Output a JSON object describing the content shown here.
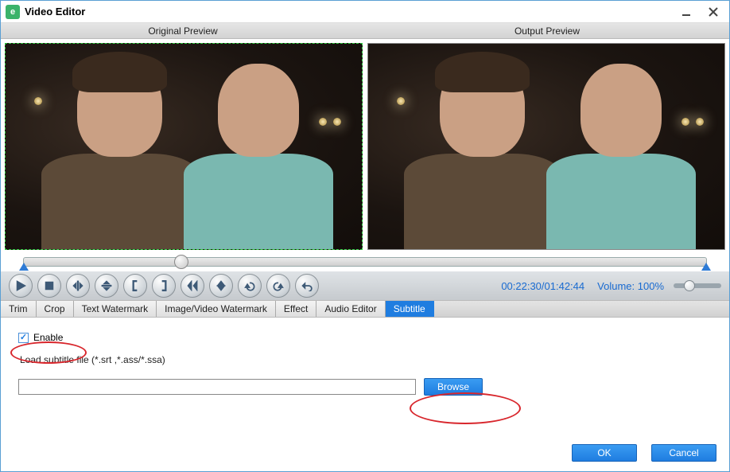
{
  "window": {
    "title": "Video Editor"
  },
  "titlebar_icons": {
    "minimize": "minimize",
    "close": "close"
  },
  "preview_headers": {
    "original": "Original Preview",
    "output": "Output Preview"
  },
  "controls": {
    "play": "play",
    "stop": "stop",
    "flip_h": "flip-horizontal",
    "flip_v": "flip-vertical",
    "bracket_in": "set-in",
    "bracket_out": "set-out",
    "goto_in": "goto-in",
    "cut": "cut",
    "rotate_ccw": "rotate-ccw",
    "rotate_cw": "rotate-cw",
    "undo": "undo"
  },
  "status": {
    "timecode": "00:22:30/01:42:44",
    "volume_label": "Volume:",
    "volume_value": "100%"
  },
  "tabs": {
    "trim": "Trim",
    "crop": "Crop",
    "text_watermark": "Text Watermark",
    "image_watermark": "Image/Video Watermark",
    "effect": "Effect",
    "audio_editor": "Audio Editor",
    "subtitle": "Subtitle",
    "active": "subtitle"
  },
  "subtitle_tab": {
    "enable_label": "Enable",
    "enable_checked": true,
    "load_label": "Load subtitle file (*.srt ,*.ass/*.ssa)",
    "file_value": "",
    "browse_label": "Browse"
  },
  "dialog": {
    "ok": "OK",
    "cancel": "Cancel"
  }
}
